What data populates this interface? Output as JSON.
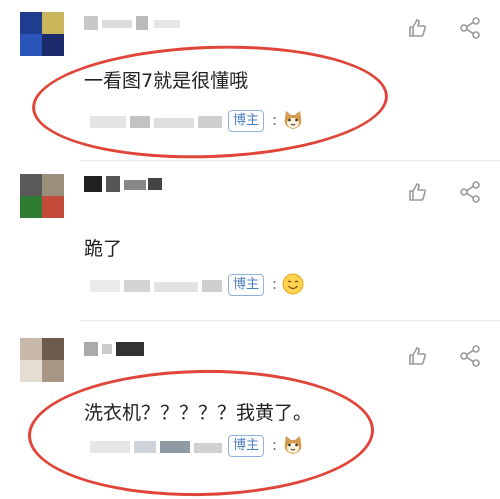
{
  "comments": [
    {
      "text": "一看图7就是很懂哦",
      "tag": "博主",
      "colon": ":"
    },
    {
      "text": "跪了",
      "tag": "博主",
      "colon": ":"
    },
    {
      "text": "洗衣机？？？？？我黄了。",
      "tag": "博主",
      "colon": ":"
    }
  ],
  "icons": {
    "like": "thumbs-up-icon",
    "share": "share-icon"
  },
  "colors": {
    "highlight_oval": "#e0453a",
    "tag_text": "#4a7fc1",
    "tag_border": "#8fb2de"
  }
}
